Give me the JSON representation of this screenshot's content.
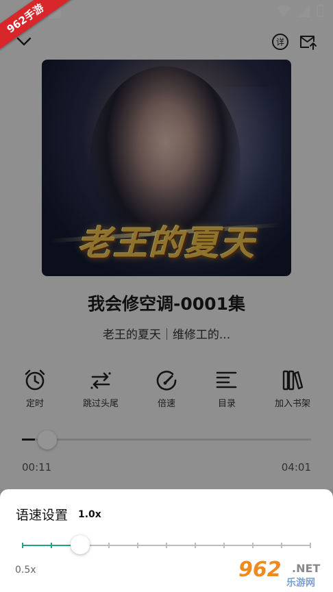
{
  "watermark_badge": "962手游",
  "track": {
    "title": "我会修空调-0001集",
    "subtitle": "老王的夏天｜维修工的..."
  },
  "cover": {
    "title_art": "老王的夏天"
  },
  "actions": [
    {
      "label": "定时",
      "icon": "alarm-clock-icon"
    },
    {
      "label": "跳过头尾",
      "icon": "skip-arrows-icon"
    },
    {
      "label": "倍速",
      "icon": "speedometer-icon"
    },
    {
      "label": "目录",
      "icon": "list-icon"
    },
    {
      "label": "加入书架",
      "icon": "bookshelf-icon"
    }
  ],
  "playback": {
    "current_time": "00:11",
    "total_time": "04:01",
    "progress_fraction": 0.045
  },
  "speed_sheet": {
    "title": "语速设置",
    "current_value": "1.0x",
    "min_label": "0.5x",
    "tick_count": 11,
    "selected_index": 2
  },
  "footer_watermark": {
    "num": "962",
    "net": ".NET",
    "cn": "乐游网"
  },
  "colors": {
    "accent": "#1fa67e",
    "ribbon": "#d9262a"
  }
}
